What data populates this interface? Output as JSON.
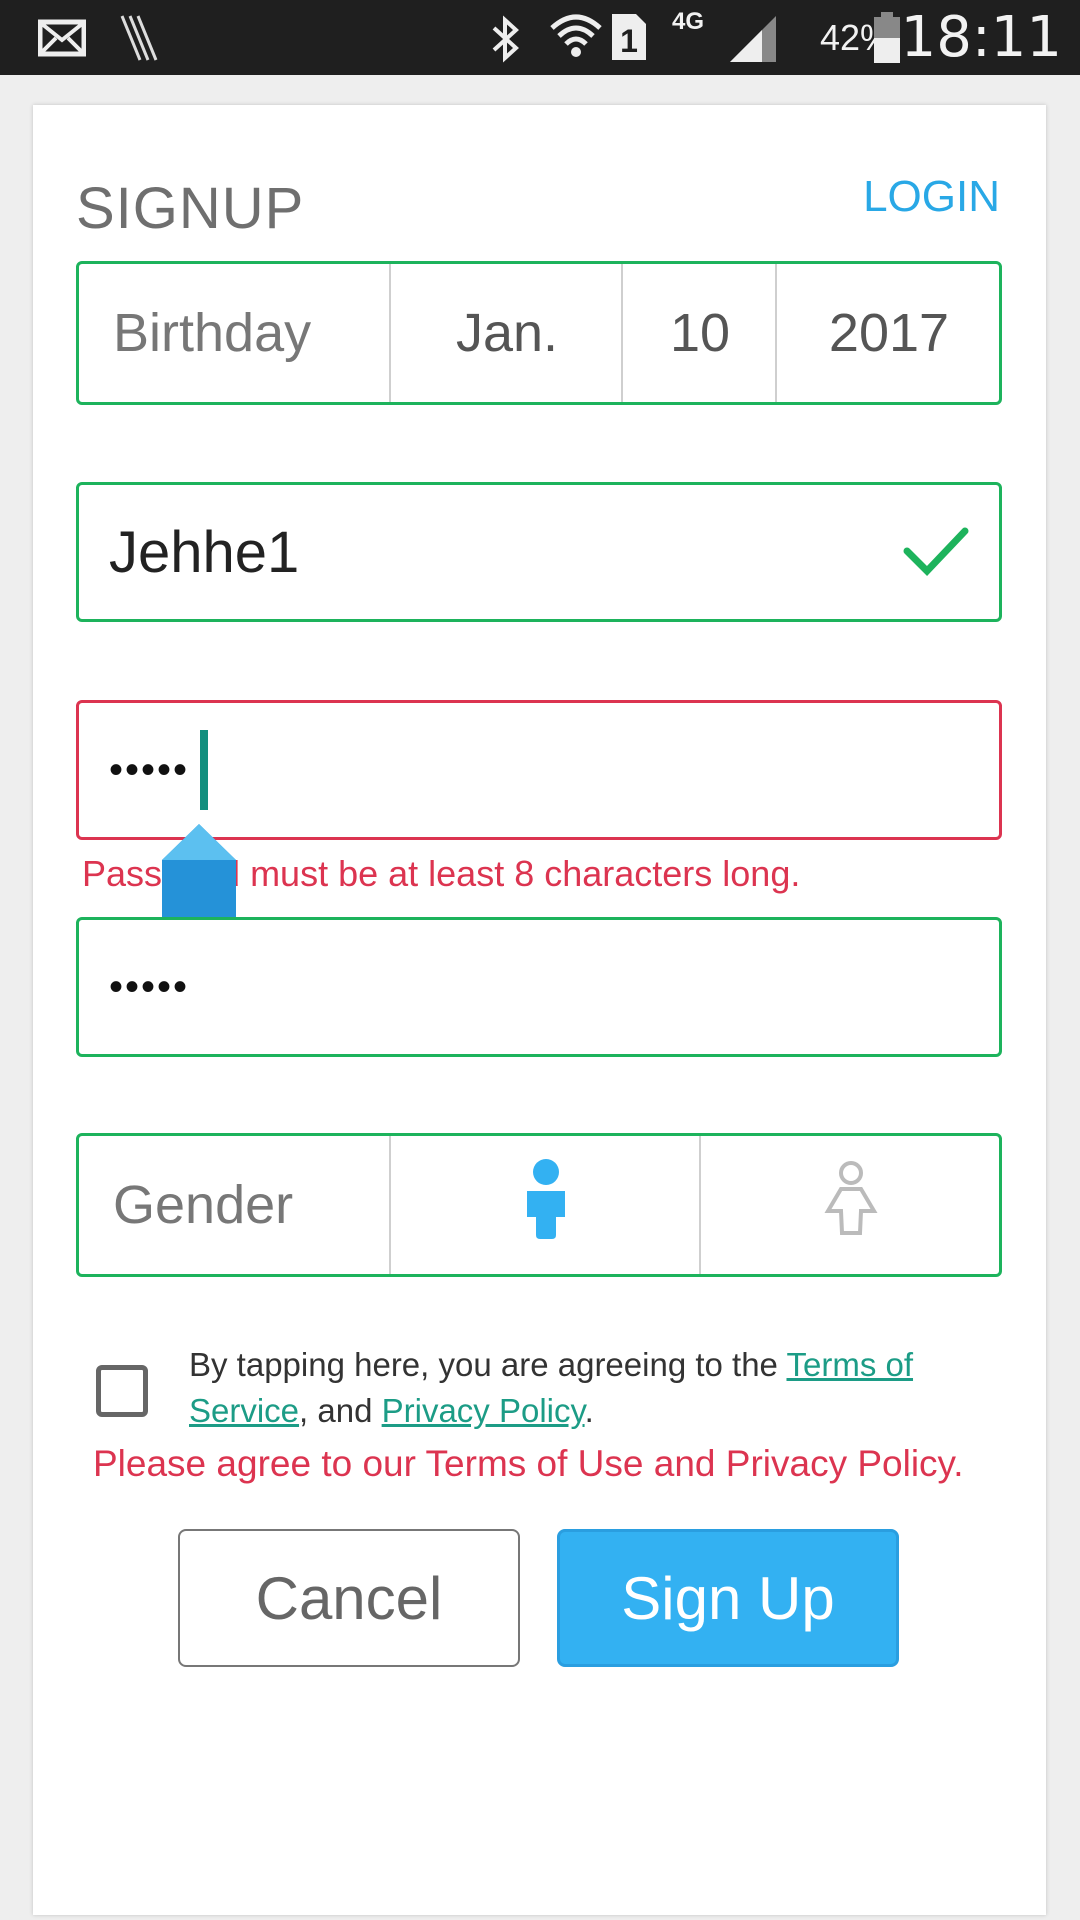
{
  "status_bar": {
    "network": "4G",
    "battery_percent": "42%",
    "time": "18:11",
    "icons": [
      "mail-icon",
      "app-icon",
      "bluetooth-icon",
      "wifi-icon",
      "sim-icon",
      "signal-icon",
      "battery-icon"
    ]
  },
  "header": {
    "title": "SIGNUP",
    "login_label": "LOGIN"
  },
  "birthday": {
    "label": "Birthday",
    "month": "Jan.",
    "day": "10",
    "year": "2017"
  },
  "username": {
    "value": "Jehhe1",
    "valid": true
  },
  "password": {
    "value": "•••••",
    "error": "Password must be at least 8 characters long."
  },
  "confirm_password": {
    "value": "•••••"
  },
  "gender": {
    "label": "Gender",
    "options": [
      "male-icon",
      "female-icon"
    ],
    "selected": "male"
  },
  "terms": {
    "prefix": "By tapping here, you are agreeing to the ",
    "tos_link": "Terms of Service",
    "middle": ", and ",
    "privacy_link": "Privacy Policy",
    "suffix": ".",
    "checked": false,
    "error": "Please agree to our Terms of Use and Privacy Policy."
  },
  "buttons": {
    "cancel": "Cancel",
    "signup": "Sign Up"
  },
  "colors": {
    "accent": "#33b1f2",
    "valid_border": "#1db35c",
    "error": "#dc3450",
    "link": "#1c9c86"
  }
}
